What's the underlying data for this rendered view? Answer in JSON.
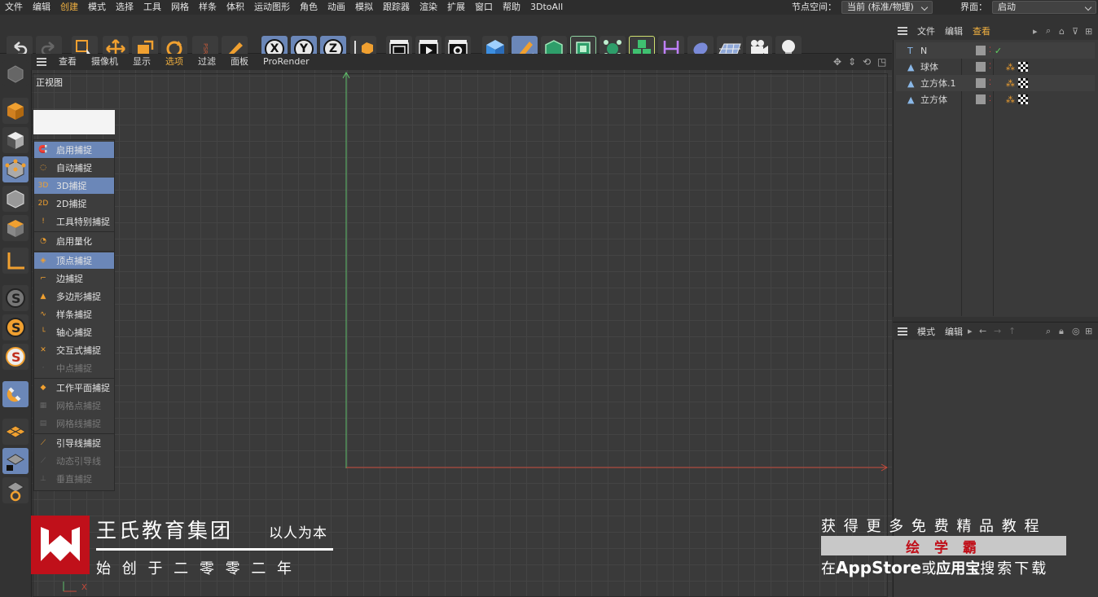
{
  "menubar": {
    "items": [
      "文件",
      "编辑",
      "创建",
      "模式",
      "选择",
      "工具",
      "网格",
      "样条",
      "体积",
      "运动图形",
      "角色",
      "动画",
      "模拟",
      "跟踪器",
      "渲染",
      "扩展",
      "窗口",
      "帮助",
      "3DtoAll"
    ],
    "node_space_label": "节点空间：",
    "node_space_value": "当前 (标准/物理)",
    "layout_label": "界面：",
    "layout_value": "启动"
  },
  "toolbar": {
    "axis_x": "X",
    "axis_y": "Y",
    "axis_z": "Z",
    "psr": "PSR"
  },
  "viewport": {
    "menu": [
      "查看",
      "摄像机",
      "显示",
      "选项",
      "过滤",
      "面板",
      "ProRender"
    ],
    "view_name": "正视图",
    "axis_label": "X"
  },
  "snap_menu": {
    "items": [
      {
        "label": "启用捕捉",
        "on": true,
        "dis": false
      },
      {
        "label": "自动捕捉",
        "on": false,
        "dis": false
      },
      {
        "label": "3D捕捉",
        "on": true,
        "dis": false
      },
      {
        "label": "2D捕捉",
        "on": false,
        "dis": false
      },
      {
        "label": "工具特别捕捉",
        "on": false,
        "dis": false
      },
      {
        "label": "启用量化",
        "on": false,
        "dis": false
      },
      {
        "label": "顶点捕捉",
        "on": true,
        "dis": false
      },
      {
        "label": "边捕捉",
        "on": false,
        "dis": false
      },
      {
        "label": "多边形捕捉",
        "on": false,
        "dis": false
      },
      {
        "label": "样条捕捉",
        "on": false,
        "dis": false
      },
      {
        "label": "轴心捕捉",
        "on": false,
        "dis": false
      },
      {
        "label": "交互式捕捉",
        "on": false,
        "dis": false
      },
      {
        "label": "中点捕捉",
        "on": false,
        "dis": true
      },
      {
        "label": "工作平面捕捉",
        "on": false,
        "dis": false
      },
      {
        "label": "网格点捕捉",
        "on": false,
        "dis": true
      },
      {
        "label": "网格线捕捉",
        "on": false,
        "dis": true
      },
      {
        "label": "引导线捕捉",
        "on": false,
        "dis": false
      },
      {
        "label": "动态引导线",
        "on": false,
        "dis": true
      },
      {
        "label": "垂直捕捉",
        "on": false,
        "dis": true
      }
    ]
  },
  "object_manager": {
    "tabs": [
      "文件",
      "编辑",
      "查看"
    ],
    "objects": [
      {
        "name": "N",
        "type": "text"
      },
      {
        "name": "球体",
        "type": "sphere"
      },
      {
        "name": "立方体.1",
        "type": "cube"
      },
      {
        "name": "立方体",
        "type": "cube"
      }
    ]
  },
  "attribute_manager": {
    "tabs": [
      "模式",
      "编辑"
    ]
  },
  "watermark": {
    "org_name": "王氏教育集团",
    "motto": "以人为本",
    "founded": "始 创 于 二 零 零 二 年",
    "right_line1": "获 得 更 多 免 费 精 品 教 程",
    "right_brand": "绘 学 霸",
    "right_line3_a": "在",
    "right_line3_b": "AppStore",
    "right_line3_c": "或",
    "right_line3_d": "应用宝",
    "right_line3_e": "搜索下载"
  },
  "colors": {
    "accent": "#6b87b8",
    "highlight_text": "#f0b040",
    "axis_x": "#c84a3a",
    "axis_y": "#5fbf6a",
    "brand_red": "#c0101a"
  }
}
